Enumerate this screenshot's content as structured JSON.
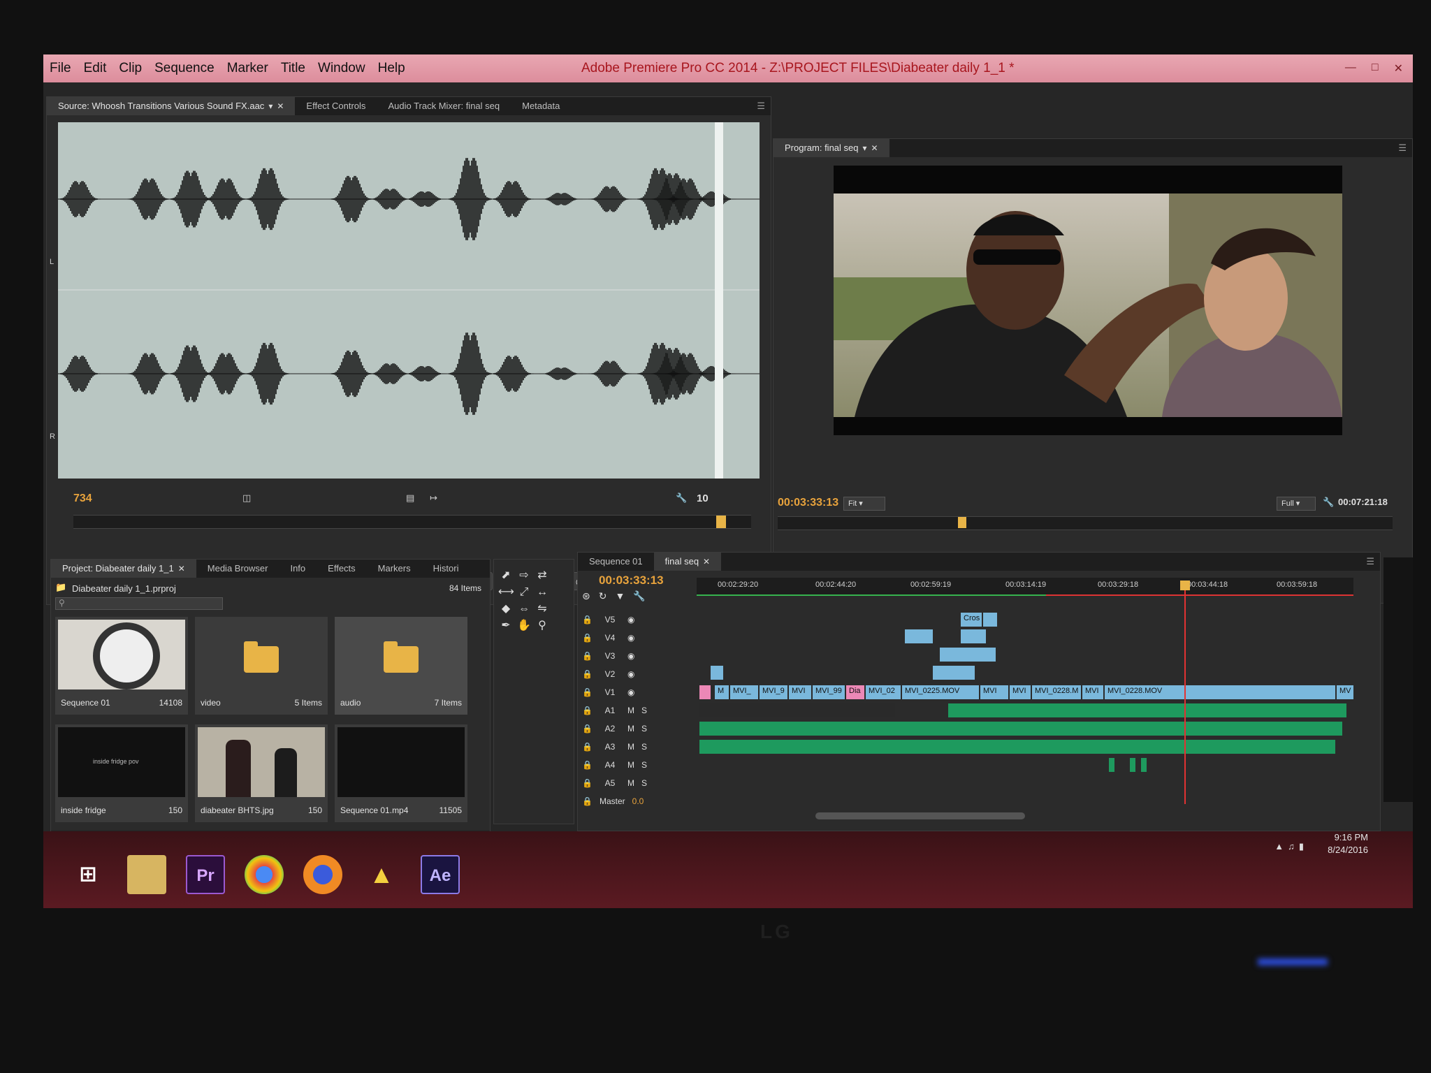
{
  "window": {
    "title": "Adobe Premiere Pro CC 2014 - Z:\\PROJECT FILES\\Diabeater daily 1_1 *",
    "menu": [
      "File",
      "Edit",
      "Clip",
      "Sequence",
      "Marker",
      "Title",
      "Window",
      "Help"
    ]
  },
  "source_panel": {
    "tabs": [
      "Source: Whoosh Transitions Various Sound FX.aac",
      "Effect Controls",
      "Audio Track Mixer: final seq",
      "Metadata"
    ],
    "channel_labels": [
      "L",
      "R"
    ],
    "timecode": "734",
    "zoom_value": "10"
  },
  "program_panel": {
    "tab": "Program: final seq",
    "timecode": "00:03:33:13",
    "fit_label": "Fit",
    "quality_label": "Full",
    "duration": "00:07:21:18"
  },
  "project_panel": {
    "tabs": [
      "Project: Diabeater daily 1_1",
      "Media Browser",
      "Info",
      "Effects",
      "Markers",
      "Histori"
    ],
    "file_name": "Diabeater daily 1_1.prproj",
    "item_count": "84 Items",
    "bins": [
      {
        "name": "Sequence 01",
        "count": "14108",
        "kind": "clock"
      },
      {
        "name": "video",
        "count": "5 Items",
        "kind": "folder"
      },
      {
        "name": "audio",
        "count": "7 Items",
        "kind": "folder"
      },
      {
        "name": "inside fridge",
        "count": "150",
        "kind": "dark",
        "caption": "inside fridge pov"
      },
      {
        "name": "diabeater BHTS.jpg",
        "count": "150",
        "kind": "photo"
      },
      {
        "name": "Sequence 01.mp4",
        "count": "11505",
        "kind": "dark"
      }
    ]
  },
  "timeline": {
    "tabs": [
      "Sequence 01",
      "final seq"
    ],
    "timecode": "00:03:33:13",
    "ruler": [
      "00:02:29:20",
      "00:02:44:20",
      "00:02:59:19",
      "00:03:14:19",
      "00:03:29:18",
      "00:03:44:18",
      "00:03:59:18"
    ],
    "video_tracks": [
      "V5",
      "V4",
      "V3",
      "V2",
      "V1"
    ],
    "audio_tracks": [
      "A1",
      "A2",
      "A3",
      "A4",
      "A5"
    ],
    "master_label": "Master",
    "master_value": "0.0",
    "clips_v1": [
      "M",
      "MVI_",
      "MVI_9",
      "MVI",
      "MVI_99",
      "Dia",
      "MVI_02",
      "MVI_0225.MOV",
      "MVI",
      "MVI",
      "MVI_0228.M",
      "MVI",
      "MVI_0228.MOV",
      "MV"
    ],
    "clip_v5": "Cros"
  },
  "taskbar": {
    "apps": [
      "Pr",
      "Ae"
    ],
    "time": "9:16 PM",
    "date": "8/24/2016"
  },
  "monitor": {
    "brand": "LG"
  },
  "colors": {
    "accent_orange": "#e8a33c",
    "playhead_red": "#e23232",
    "video_clip": "#7ab8dc",
    "audio_clip": "#1e9a5e"
  }
}
